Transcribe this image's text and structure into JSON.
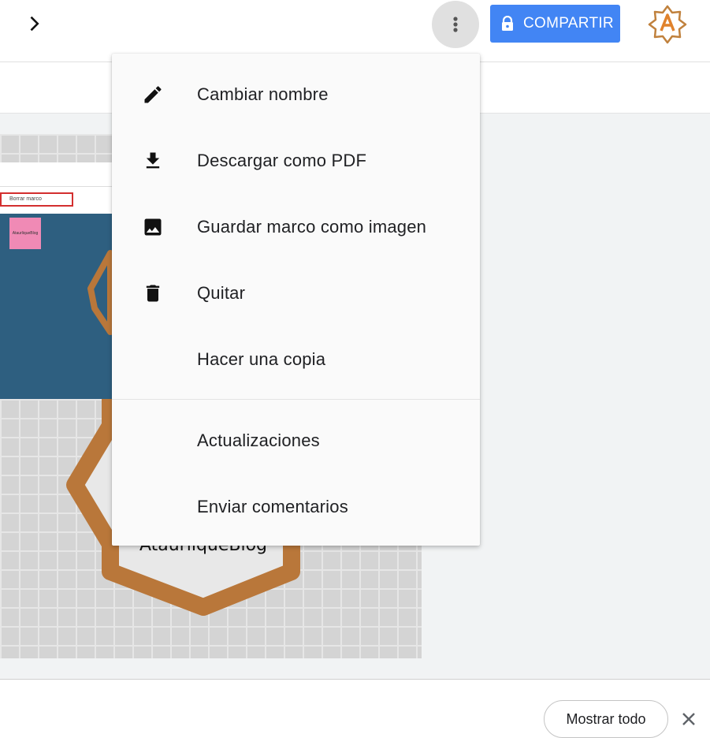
{
  "toolbar": {
    "share_label": "COMPARTIR",
    "accent_color": "#4285f4",
    "icons": [
      "chevron-right-icon",
      "more-vert-icon",
      "lock-icon",
      "avatar-star-icon"
    ]
  },
  "menu": {
    "items": [
      {
        "label": "Cambiar nombre",
        "icon": "pencil-icon"
      },
      {
        "label": "Descargar como PDF",
        "icon": "download-icon"
      },
      {
        "label": "Guardar marco como imagen",
        "icon": "image-icon"
      },
      {
        "label": "Quitar",
        "icon": "trash-icon"
      },
      {
        "label": "Hacer una copia",
        "icon": ""
      }
    ],
    "secondary_items": [
      {
        "label": "Actualizaciones"
      },
      {
        "label": "Enviar comentarios"
      }
    ]
  },
  "frame": {
    "field_text": "Borrar marco",
    "note_text": "AtaurliqueBlog"
  },
  "bottom": {
    "show_all_label": "Mostrar todo"
  }
}
